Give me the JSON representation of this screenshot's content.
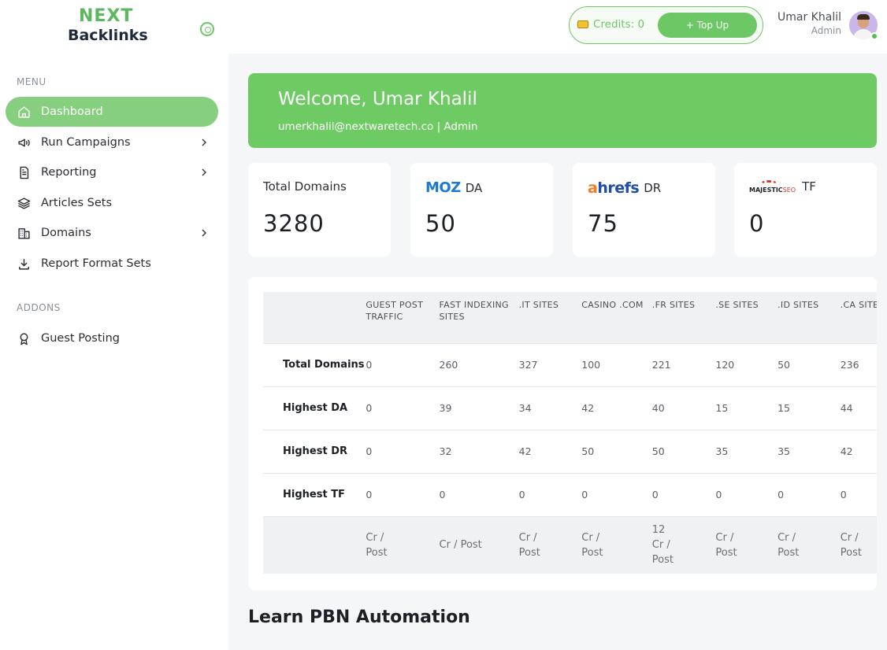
{
  "brand": {
    "logo_top": "NEXT",
    "logo_bottom": "Backlinks"
  },
  "sidebar": {
    "menu_heading": "MENU",
    "items": [
      {
        "label": "Dashboard",
        "icon": "home-icon",
        "active": true
      },
      {
        "label": "Run Campaigns",
        "icon": "megaphone-icon",
        "has_submenu": true
      },
      {
        "label": "Reporting",
        "icon": "document-icon",
        "has_submenu": true
      },
      {
        "label": "Articles Sets",
        "icon": "layers-icon"
      },
      {
        "label": "Domains",
        "icon": "buildings-icon",
        "has_submenu": true
      },
      {
        "label": "Report Format Sets",
        "icon": "download-icon"
      }
    ],
    "addons_heading": "ADDONS",
    "addons": [
      {
        "label": "Guest Posting",
        "icon": "award-icon"
      }
    ]
  },
  "header": {
    "credits_label": "Credits: 0",
    "topup_label": "+ Top Up",
    "user_name": "Umar Khalil",
    "user_role": "Admin"
  },
  "welcome": {
    "title": "Welcome, Umar Khalil",
    "subtitle": "umerkhalil@nextwaretech.co | Admin"
  },
  "stats": [
    {
      "label": "Total Domains",
      "value": "3280"
    },
    {
      "brand": "MOZ",
      "label": "DA",
      "value": "50"
    },
    {
      "brand_a": "a",
      "brand_rest": "hrefs",
      "label": "DR",
      "value": "75"
    },
    {
      "brand": "MAJESTIC",
      "brand_suffix": "SEO",
      "label": "TF",
      "value": "0"
    }
  ],
  "table": {
    "columns": [
      "GUEST POST TRAFFIC",
      "FAST INDEXING SITES",
      ".IT SITES",
      "CASINO .COM",
      ".FR SITES",
      ".SE SITES",
      ".ID SITES",
      ".CA SITES"
    ],
    "rows": [
      {
        "label": "Total Domains",
        "values": [
          "0",
          "260",
          "327",
          "100",
          "221",
          "120",
          "50",
          "236"
        ]
      },
      {
        "label": "Highest DA",
        "values": [
          "0",
          "39",
          "34",
          "42",
          "40",
          "15",
          "15",
          "44"
        ]
      },
      {
        "label": "Highest DR",
        "values": [
          "0",
          "32",
          "42",
          "50",
          "50",
          "35",
          "35",
          "42"
        ]
      },
      {
        "label": "Highest TF",
        "values": [
          "0",
          "0",
          "0",
          "0",
          "0",
          "0",
          "0",
          "0"
        ]
      }
    ],
    "footer": [
      "Cr / Post",
      "Cr / Post",
      "Cr / Post",
      "Cr / Post",
      "12 Cr / Post",
      "Cr / Post",
      "Cr / Post",
      "Cr / Post"
    ]
  },
  "section_title": "Learn PBN Automation",
  "colors": {
    "accent": "#6ecb63",
    "active_nav": "#86cf7e"
  }
}
